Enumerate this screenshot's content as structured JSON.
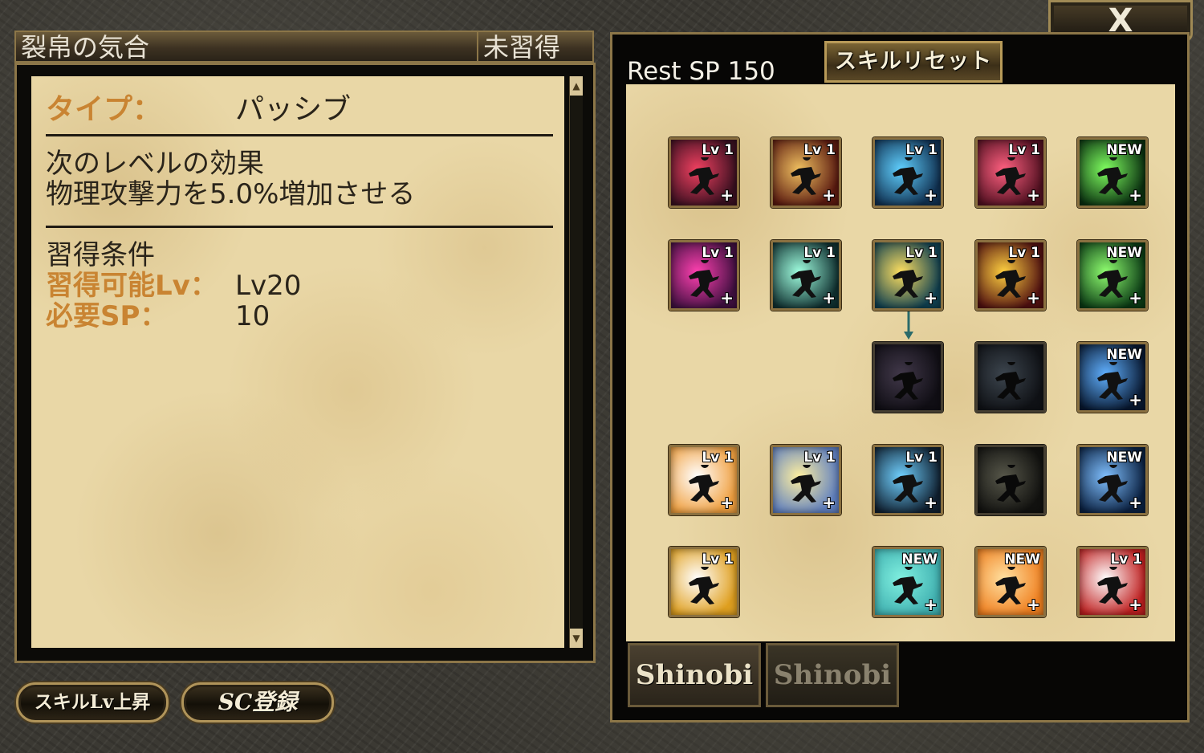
{
  "detail": {
    "skill_name": "裂帛の気合",
    "status": "未習得",
    "type_label": "タイプ：",
    "type_value": "パッシブ",
    "next_level_heading": "次のレベルの効果",
    "effect_text": "物理攻撃力を5.0%増加させる",
    "requirements_heading": "習得条件",
    "req_level_label": "習得可能Lv：",
    "req_level_value": "Lv20",
    "req_sp_label": "必要SP：",
    "req_sp_value": "10",
    "scroll_up": "▲",
    "scroll_down": "▼"
  },
  "close": {
    "label": "X"
  },
  "skill_tree": {
    "rest_sp": "Rest SP 150",
    "reset_label": "スキルリセット",
    "tabs": [
      "Shinobi",
      "Shinobi"
    ],
    "rows": [
      [
        {
          "badge": "Lv 1",
          "icon": "ninja-kick-icon",
          "colors": [
            "#f04060",
            "#3a1020"
          ],
          "plus": "+",
          "locked": false
        },
        {
          "badge": "Lv 1",
          "icon": "ninja-slash-icon",
          "colors": [
            "#f0c060",
            "#5a1a10"
          ],
          "plus": "+",
          "locked": false
        },
        {
          "badge": "Lv 1",
          "icon": "ninja-dash-icon",
          "colors": [
            "#60d0ff",
            "#103050"
          ],
          "plus": "+",
          "locked": false
        },
        {
          "badge": "Lv 1",
          "icon": "ninja-spin-icon",
          "colors": [
            "#ff6080",
            "#501020"
          ],
          "plus": "+",
          "locked": false
        },
        {
          "badge": "NEW",
          "icon": "green-orb-icon",
          "colors": [
            "#80ff60",
            "#0a3010"
          ],
          "plus": "+",
          "locked": false
        }
      ],
      [
        {
          "badge": "Lv 1",
          "icon": "ninja-whirl-icon",
          "colors": [
            "#ff40b0",
            "#401040"
          ],
          "plus": "+",
          "locked": false
        },
        {
          "badge": "Lv 1",
          "icon": "ninja-leap-icon",
          "colors": [
            "#a0ffe0",
            "#103030"
          ],
          "plus": "+",
          "locked": false
        },
        {
          "badge": "Lv 1",
          "icon": "ninja-strike-icon",
          "colors": [
            "#ffe060",
            "#104050"
          ],
          "plus": "+",
          "locked": false
        },
        {
          "badge": "Lv 1",
          "icon": "ninja-flash-icon",
          "colors": [
            "#ffd040",
            "#501010"
          ],
          "plus": "+",
          "locked": false
        },
        {
          "badge": "NEW",
          "icon": "green-potion-icon",
          "colors": [
            "#90ff70",
            "#0a3a14"
          ],
          "plus": "+",
          "locked": false
        }
      ],
      [
        null,
        null,
        {
          "badge": "",
          "icon": "locked-ninja-icon",
          "colors": [
            "#8060a0",
            "#201830"
          ],
          "plus": "",
          "locked": true
        },
        {
          "badge": "",
          "icon": "locked-ninja-icon",
          "colors": [
            "#6080a0",
            "#182030"
          ],
          "plus": "",
          "locked": true
        },
        {
          "badge": "NEW",
          "icon": "blue-orb-icon",
          "colors": [
            "#60b0ff",
            "#081830"
          ],
          "plus": "+",
          "locked": false
        }
      ],
      [
        {
          "badge": "Lv 1",
          "icon": "ninja-counter-icon",
          "colors": [
            "#ffffff",
            "#f0a040"
          ],
          "plus": "+",
          "locked": false
        },
        {
          "badge": "Lv 1",
          "icon": "ninja-sprint-icon",
          "colors": [
            "#fff0a0",
            "#6080c0"
          ],
          "plus": "+",
          "locked": false
        },
        {
          "badge": "Lv 1",
          "icon": "ninja-dive-icon",
          "colors": [
            "#70d0ff",
            "#102030"
          ],
          "plus": "+",
          "locked": false
        },
        {
          "badge": "",
          "icon": "locked-ninja-icon",
          "colors": [
            "#a0a070",
            "#202018"
          ],
          "plus": "",
          "locked": true
        },
        {
          "badge": "NEW",
          "icon": "blue-potion-icon",
          "colors": [
            "#80c0ff",
            "#0a2040"
          ],
          "plus": "+",
          "locked": false
        }
      ],
      [
        {
          "badge": "Lv 1",
          "icon": "ninja-smoke-icon",
          "colors": [
            "#ffffff",
            "#e0a020"
          ],
          "plus": "",
          "locked": false
        },
        null,
        {
          "badge": "NEW",
          "icon": "sword-icon",
          "colors": [
            "#80f0e0",
            "#40b0b0"
          ],
          "plus": "+",
          "locked": false
        },
        {
          "badge": "NEW",
          "icon": "shield-icon",
          "colors": [
            "#ffe0a0",
            "#f08020"
          ],
          "plus": "+",
          "locked": false
        },
        {
          "badge": "Lv 1",
          "icon": "ninja-throw-icon",
          "colors": [
            "#ffffff",
            "#c02020"
          ],
          "plus": "+",
          "locked": false
        }
      ]
    ]
  },
  "buttons": {
    "skill_lv_up": "スキルLv上昇",
    "sc_register": "SC登録"
  }
}
